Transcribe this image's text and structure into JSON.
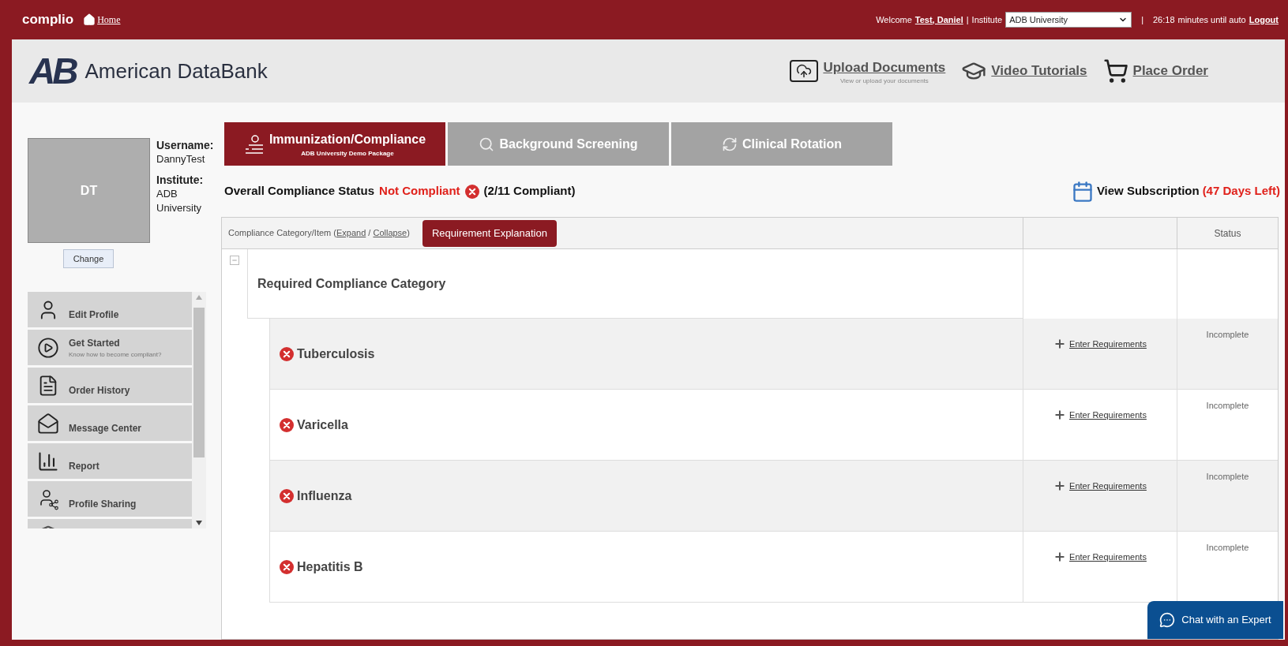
{
  "top_bar": {
    "logo": "complio",
    "home_link": "Home",
    "welcome_label": "Welcome",
    "user_link": "Test, Daniel",
    "separator": "|",
    "institute_label": "Institute",
    "institute_select": "ADB University",
    "separator_2": "|",
    "timer": "26:18",
    "timer_text": "minutes until auto",
    "logout_link": "Logout"
  },
  "header": {
    "logo_mark": "AB",
    "brand": "American DataBank",
    "actions": [
      {
        "kind": "upload",
        "label": "Upload Documents",
        "subtitle": "View or upload your documents"
      },
      {
        "kind": "video",
        "label": "Video Tutorials"
      },
      {
        "kind": "order",
        "label": "Place Order"
      }
    ]
  },
  "profile": {
    "initials": "DT",
    "username_label": "Username:",
    "username": "DannyTest",
    "institute_label": "Institute:",
    "institute": "ADB University",
    "change_button": "Change"
  },
  "sidebar": {
    "items": [
      {
        "kind": "profile",
        "label": "Edit Profile"
      },
      {
        "kind": "start",
        "label": "Get Started",
        "subtitle": "Know how to become compliant?"
      },
      {
        "kind": "orders",
        "label": "Order History"
      },
      {
        "kind": "messages",
        "label": "Message Center"
      },
      {
        "kind": "report",
        "label": "Report"
      },
      {
        "kind": "sharing",
        "label": "Profile Sharing"
      }
    ]
  },
  "tabs": [
    {
      "kind": "immunization",
      "label": "Immunization/Compliance",
      "subtitle": "ADB University Demo Package",
      "selected": true
    },
    {
      "kind": "background",
      "label": "Background Screening",
      "selected": false
    },
    {
      "kind": "clinical",
      "label": "Clinical Rotation",
      "selected": false
    }
  ],
  "compliance": {
    "label": "Overall Compliance Status",
    "status": "Not Compliant",
    "count": "(2/11 Compliant)",
    "subscription_link": "View Subscription",
    "days_left": "(47 Days Left)"
  },
  "table": {
    "header_prefix": "Compliance Category/Item (",
    "expand_link": "Expand",
    "slash": " / ",
    "collapse_link": "Collapse",
    "header_suffix": ")",
    "explanation_button": "Requirement Explanation",
    "status_column": "Status",
    "category": "Required Compliance Category",
    "rows": [
      {
        "name": "Tuberculosis",
        "action": "Enter Requirements",
        "status": "Incomplete"
      },
      {
        "name": "Varicella",
        "action": "Enter Requirements",
        "status": "Incomplete"
      },
      {
        "name": "Influenza",
        "action": "Enter Requirements",
        "status": "Incomplete"
      },
      {
        "name": "Hepatitis B",
        "action": "Enter Requirements",
        "status": "Incomplete"
      }
    ]
  },
  "chat_button": "Chat with an Expert"
}
